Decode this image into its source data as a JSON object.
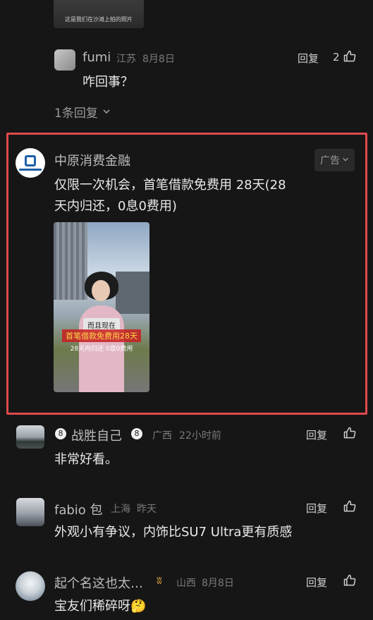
{
  "top_thumb": {
    "caption": "这是我们在沙滩上拍的照片"
  },
  "comments": [
    {
      "user": "fumi",
      "location": "江苏",
      "date": "8月8日",
      "text": "咋回事？",
      "reply_label": "回复",
      "likes": "2",
      "replies_toggle": "1条回复"
    },
    {
      "user": "战胜自己",
      "location": "广西",
      "date": "22小时前",
      "text": "非常好看。",
      "reply_label": "回复",
      "likes": ""
    },
    {
      "user": "fabio 包",
      "location": "上海",
      "date": "昨天",
      "text": "外观小有争议，内饰比SU7 Ultra更有质感",
      "reply_label": "回复",
      "likes": ""
    },
    {
      "user": "起个名这也太…",
      "location": "山西",
      "date": "8月8日",
      "text": "宝友们稀碎呀🤔",
      "reply_label": "回复",
      "likes": ""
    }
  ],
  "ad": {
    "advertiser": "中原消费金融",
    "badge": "广告",
    "text": "仅限一次机会，首笔借款免费用 28天(28 天内归还，0息0费用)",
    "video_caption_top": "而且现在",
    "video_caption_main": "首笔借款免费用28天",
    "video_caption_small": "28天内归还 0息0费用",
    "colors": {
      "highlight": "#e0494d"
    }
  },
  "icons": {
    "like": "thumb-up-icon",
    "chevron": "chevron-down-icon"
  }
}
